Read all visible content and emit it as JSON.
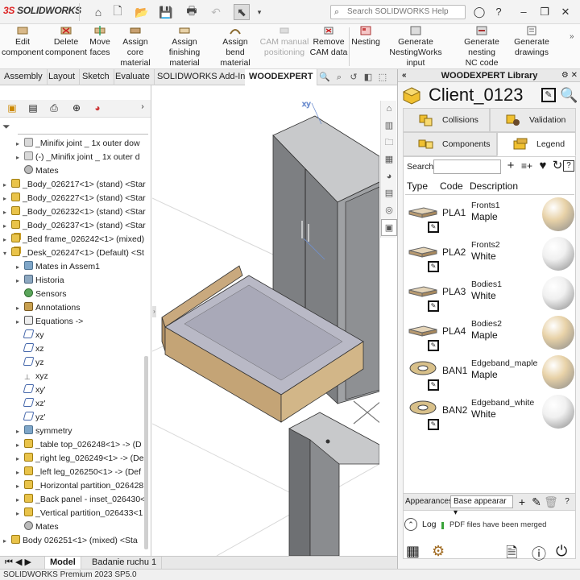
{
  "app": {
    "logo": "SOLIDWORKS",
    "search_placeholder": "Search SOLIDWORKS Help",
    "status": "SOLIDWORKS Premium 2023 SP5.0"
  },
  "ribbon": {
    "items": [
      {
        "l1": "Edit",
        "l2": "component"
      },
      {
        "l1": "Delete",
        "l2": "component"
      },
      {
        "l1": "Move",
        "l2": "faces"
      },
      {
        "l1": "Assign core",
        "l2": "material"
      },
      {
        "l1": "Assign finishing",
        "l2": "material"
      },
      {
        "l1": "Assign bend",
        "l2": "material"
      },
      {
        "l1": "CAM manual",
        "l2": "positioning"
      },
      {
        "l1": "Remove",
        "l2": "CAM data"
      },
      {
        "l1": "Nesting",
        "l2": ""
      },
      {
        "l1": "Generate",
        "l2": "NestingWorks input"
      },
      {
        "l1": "Generate nesting",
        "l2": "NC code"
      },
      {
        "l1": "Generate",
        "l2": "drawings"
      }
    ]
  },
  "tabs": [
    "Assembly",
    "Layout",
    "Sketch",
    "Evaluate",
    "SOLIDWORKS Add-Ins",
    "WOODEXPERT"
  ],
  "tree": {
    "items": [
      {
        "t": "_Minifix joint _ 1x outer dow",
        "ic": "joint",
        "d": 1,
        "a": "▸"
      },
      {
        "t": "(-) _Minifix joint _ 1x outer d",
        "ic": "joint",
        "d": 1,
        "a": "▸"
      },
      {
        "t": "Mates",
        "ic": "mates",
        "d": 1,
        "a": ""
      },
      {
        "t": "_Body_026217<1> (stand) <Star",
        "ic": "part",
        "d": 0,
        "a": "▸"
      },
      {
        "t": "_Body_026227<1> (stand) <Star",
        "ic": "part",
        "d": 0,
        "a": "▸"
      },
      {
        "t": "_Body_026232<1> (stand) <Star",
        "ic": "part",
        "d": 0,
        "a": "▸"
      },
      {
        "t": "_Body_026237<1> (stand) <Star",
        "ic": "part",
        "d": 0,
        "a": "▸"
      },
      {
        "t": "_Bed frame_026242<1> (mixed)",
        "ic": "asm",
        "d": 0,
        "a": "▸"
      },
      {
        "t": "_Desk_026247<1> (Default) <St",
        "ic": "asm",
        "d": 0,
        "a": "▾"
      },
      {
        "t": "Mates in Assem1",
        "ic": "folder",
        "d": 1,
        "a": "▸"
      },
      {
        "t": "Historia",
        "ic": "hist",
        "d": 1,
        "a": "▸"
      },
      {
        "t": "Sensors",
        "ic": "sens",
        "d": 1,
        "a": ""
      },
      {
        "t": "Annotations",
        "ic": "ann",
        "d": 1,
        "a": "▸"
      },
      {
        "t": "Equations ->",
        "ic": "eq",
        "d": 1,
        "a": "▸"
      },
      {
        "t": "xy",
        "ic": "plane",
        "d": 1,
        "a": ""
      },
      {
        "t": "xz",
        "ic": "plane",
        "d": 1,
        "a": ""
      },
      {
        "t": "yz",
        "ic": "plane",
        "d": 1,
        "a": ""
      },
      {
        "t": "xyz",
        "ic": "xyz",
        "d": 1,
        "a": ""
      },
      {
        "t": "xy'",
        "ic": "plane",
        "d": 1,
        "a": ""
      },
      {
        "t": "xz'",
        "ic": "plane",
        "d": 1,
        "a": ""
      },
      {
        "t": "yz'",
        "ic": "plane",
        "d": 1,
        "a": ""
      },
      {
        "t": "symmetry",
        "ic": "folder",
        "d": 1,
        "a": "▸"
      },
      {
        "t": "_table top_026248<1> -> (D",
        "ic": "part",
        "d": 1,
        "a": "▸"
      },
      {
        "t": "_right leg_026249<1> -> (De",
        "ic": "part",
        "d": 1,
        "a": "▸"
      },
      {
        "t": "_left leg_026250<1> -> (Def",
        "ic": "part",
        "d": 1,
        "a": "▸"
      },
      {
        "t": "_Horizontal partition_026428",
        "ic": "part",
        "d": 1,
        "a": "▸"
      },
      {
        "t": "_Back panel - inset_026430<",
        "ic": "part",
        "d": 1,
        "a": "▸"
      },
      {
        "t": "_Vertical partition_026433<1",
        "ic": "part",
        "d": 1,
        "a": "▸"
      },
      {
        "t": "Mates",
        "ic": "mates",
        "d": 1,
        "a": ""
      },
      {
        "t": "Body 026251<1> (mixed) <Sta",
        "ic": "part",
        "d": 0,
        "a": "▸"
      }
    ]
  },
  "bottom_tabs": [
    "Model",
    "Badanie ruchu 1"
  ],
  "woodexpert": {
    "title": "WOODEXPERT Library",
    "client": "Client_0123",
    "tabs": [
      "Collisions",
      "Validation",
      "Components",
      "Legend"
    ],
    "search_label": "Search",
    "columns": [
      "Type",
      "Code",
      "Description"
    ],
    "rows": [
      {
        "code": "PLA1",
        "d1": "Fronts1",
        "d2": "Maple",
        "kind": "board",
        "color": "#e8d2a8"
      },
      {
        "code": "PLA2",
        "d1": "Fronts2",
        "d2": "White",
        "kind": "board",
        "color": "#f0f0f0"
      },
      {
        "code": "PLA3",
        "d1": "Bodies1",
        "d2": "White",
        "kind": "board",
        "color": "#f0f0f0"
      },
      {
        "code": "PLA4",
        "d1": "Bodies2",
        "d2": "Maple",
        "kind": "board",
        "color": "#e8d2a8"
      },
      {
        "code": "BAN1",
        "d1": "Edgeband_maple",
        "d2": "Maple",
        "kind": "band",
        "color": "#e8d2a8"
      },
      {
        "code": "BAN2",
        "d1": "Edgeband_white",
        "d2": "White",
        "kind": "band",
        "color": "#f0f0f0"
      }
    ],
    "appearances_label": "Appearances",
    "appearance_select": "Base appearar",
    "log_label": "Log",
    "log_msg": "PDF files have been merged"
  },
  "colors": {
    "accent": "#1f5fa8",
    "maple": "#d9b98a",
    "white": "#e8e8e8",
    "panel_grey": "#7d7f82"
  }
}
